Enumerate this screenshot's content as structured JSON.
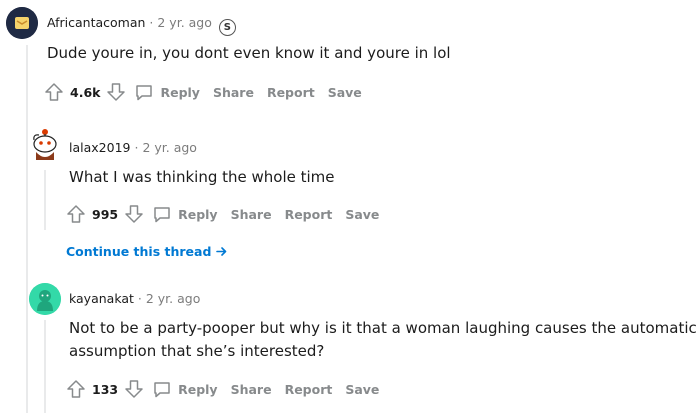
{
  "comments": [
    {
      "username": "Africantacoman",
      "time": "2 yr. ago",
      "award": "S",
      "body": "Dude youre in, you dont even know it and youre in lol",
      "score": "4.6k",
      "actions": [
        "Reply",
        "Share",
        "Report",
        "Save"
      ]
    },
    {
      "username": "lalax2019",
      "time": "2 yr. ago",
      "body": "What I was thinking the whole time",
      "score": "995",
      "actions": [
        "Reply",
        "Share",
        "Report",
        "Save"
      ],
      "continue": "Continue this thread"
    },
    {
      "username": "kayanakat",
      "time": "2 yr. ago",
      "body_lines": [
        "Not to be a party-pooper but why is it that a woman laughing causes the automatic",
        "assumption that she’s interested?"
      ],
      "score": "133",
      "actions": [
        "Reply",
        "Share",
        "Report",
        "Save"
      ]
    }
  ],
  "colors": {
    "link": "#0079d3",
    "muted": "#878a8c",
    "thread_line": "#e9eaeb"
  }
}
